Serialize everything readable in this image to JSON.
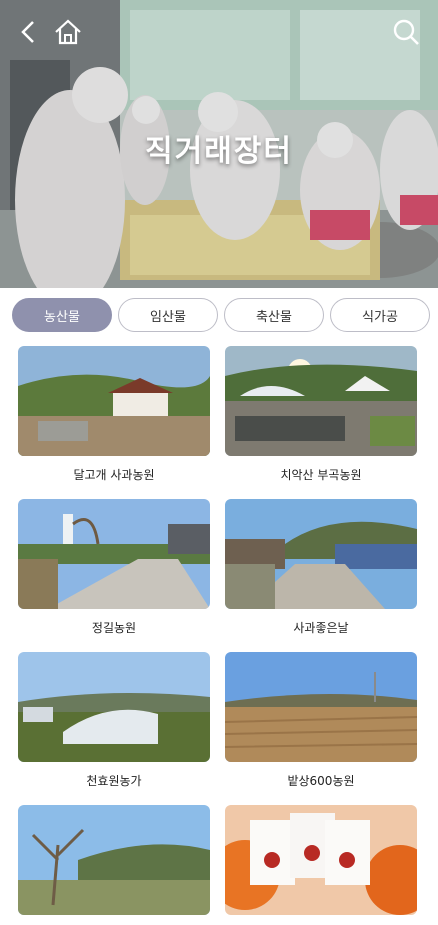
{
  "hero": {
    "title": "직거래장터"
  },
  "tabs": [
    {
      "label": "농산물",
      "active": true
    },
    {
      "label": "임산물",
      "active": false
    },
    {
      "label": "축산물",
      "active": false
    },
    {
      "label": "식가공",
      "active": false
    }
  ],
  "farms": [
    {
      "name": "달고개 사과농원"
    },
    {
      "name": "치악산 부곡농원"
    },
    {
      "name": "정길농원"
    },
    {
      "name": "사과좋은날"
    },
    {
      "name": "천효원농가"
    },
    {
      "name": "밭상600농원"
    },
    {
      "name": ""
    },
    {
      "name": ""
    }
  ],
  "icons": {
    "back": "chevron-left-icon",
    "home": "home-icon",
    "search": "search-icon"
  },
  "colors": {
    "active_tab": "#8f91ad",
    "tab_border": "#bdbdc7"
  }
}
